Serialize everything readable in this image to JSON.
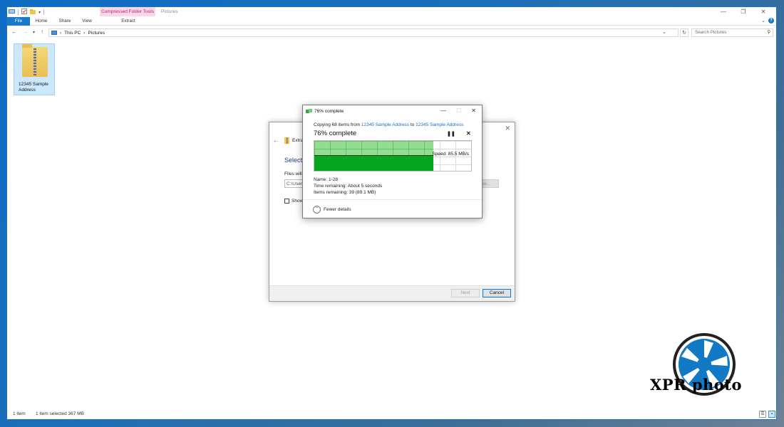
{
  "explorer": {
    "context_tab": "Compressed Folder Tools",
    "window_title": "Pictures",
    "ribbon_tabs": [
      "File",
      "Home",
      "Share",
      "View"
    ],
    "context_subtab": "Extract",
    "breadcrumb": [
      "This PC",
      "Pictures"
    ],
    "search_placeholder": "Search Pictures",
    "file_name_line1": "12345 Sample",
    "file_name_line2": "Address",
    "status_items": "1 item",
    "status_selected": "1 item selected  367 MB",
    "accent_color": "#1979ca"
  },
  "wizard": {
    "title_fragment": "Extra",
    "heading_fragment": "Select",
    "files_label_fragment": "Files will",
    "path_fragment": "C:\\User",
    "browse_fragment": "se...",
    "show_fragment": "Show",
    "next_label": "Next",
    "cancel_label": "Cancel"
  },
  "copy_dialog": {
    "title": "76% complete",
    "copying_prefix": "Copying 68 items from",
    "source_link": "12345 Sample Address",
    "to_word": "to",
    "dest_link": "12345 Sample Address",
    "percent_text": "76% complete",
    "percent_value": 0.76,
    "speed_text": "Speed: 85.5 MB/s",
    "speed_level": 0.5,
    "name_line": "Name: 1-28",
    "time_line": "Time remaining:  About 5 seconds",
    "items_line": "Items remaining:  39 (89.1 MB)",
    "fewer_details": "Fewer details",
    "graph_light_color": "#7fd97f",
    "graph_dark_color": "#06a51e"
  },
  "watermark": {
    "text": "XPR photo",
    "ring_color": "#1279c4"
  }
}
